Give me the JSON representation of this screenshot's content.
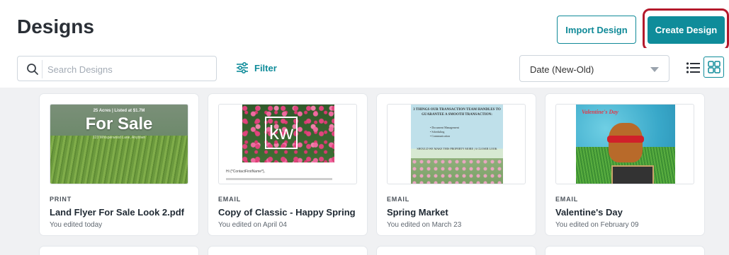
{
  "header": {
    "title": "Designs",
    "import_label": "Import Design",
    "create_label": "Create Design"
  },
  "toolbar": {
    "search_placeholder": "Search Designs",
    "filter_label": "Filter",
    "sort_value": "Date (New-Old)"
  },
  "colors": {
    "accent": "#0f8c9a",
    "highlight_outline": "#b4192b",
    "content_bg": "#f0f1f3"
  },
  "designs": [
    {
      "type": "PRINT",
      "title": "Land Flyer For Sale Look 2.pdf",
      "meta": "You edited today",
      "thumb": {
        "line1": "25 Acres | Listed at $1.7M",
        "big": "For Sale",
        "line2": "123 Whisperwood Lane, Anytown"
      }
    },
    {
      "type": "EMAIL",
      "title": "Copy of Classic - Happy Spring",
      "meta": "You edited on April 04",
      "thumb": {
        "logo": "kw",
        "greeting": "Hi {*ContactFirstName*},"
      }
    },
    {
      "type": "EMAIL",
      "title": "Spring Market",
      "meta": "You edited on March 23",
      "thumb": {
        "heading": "3 THINGS OUR TRANSACTION TEAM HANDLES TO GUARANTEE A SMOOTH TRANSACTION:",
        "bullets": [
          "• Document Management",
          "• Scheduling",
          "• Communication"
        ],
        "middle": "SHOULD WE MAKE THIS PROPERTY MORE | A CLOSER LOOK"
      }
    },
    {
      "type": "EMAIL",
      "title": "Valentine's Day",
      "meta": "You edited on February 09",
      "thumb": {
        "title": "Valentine's Day"
      }
    }
  ]
}
